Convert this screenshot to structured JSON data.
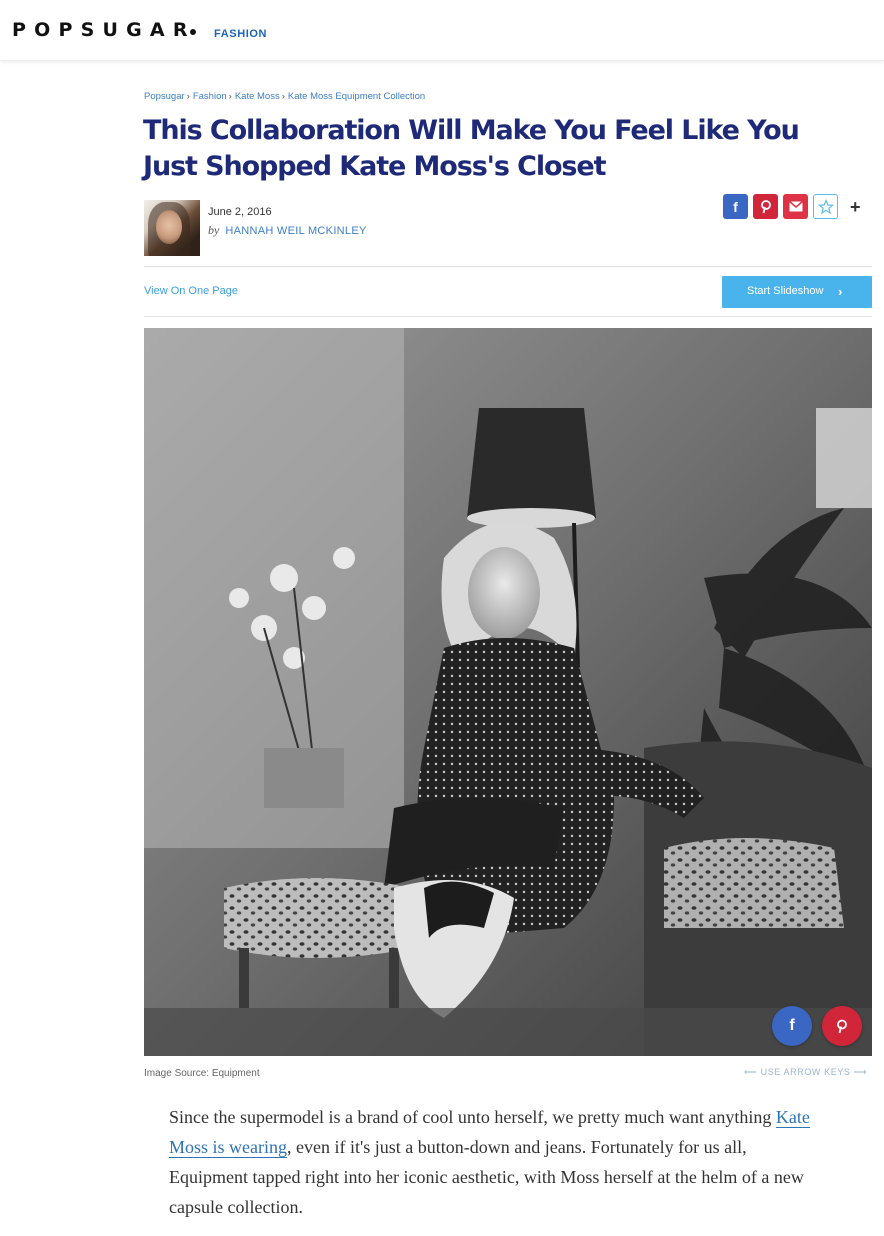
{
  "header": {
    "logo_text": "POPSUGAR",
    "section": "FASHION"
  },
  "breadcrumb": [
    "Popsugar",
    "Fashion",
    "Kate Moss",
    "Kate Moss Equipment Collection"
  ],
  "article": {
    "title": "This Collaboration Will Make You Feel Like You Just Shopped Kate Moss's Closet",
    "date": "June 2, 2016",
    "by_label": "by",
    "author": "HANNAH WEIL MCKINLEY",
    "view_one_page": "View On One Page",
    "start_slideshow": "Start Slideshow",
    "image_source": "Image Source: Equipment",
    "arrow_keys_hint": "⟵ USE ARROW KEYS ⟶",
    "body_before_link": "Since the supermodel is a brand of cool unto herself, we pretty much want anything ",
    "body_link": "Kate Moss is wearing",
    "body_after_link": ", even if it's just a button-down and jeans. Fortunately for us all, Equipment tapped right into her iconic aesthetic, with Moss herself at the helm of a new capsule collection."
  },
  "share": {
    "facebook_icon": "f",
    "pinterest_icon": "P",
    "email_icon": "✉",
    "favorite_icon": "☆",
    "more_icon": "+"
  },
  "colors": {
    "title": "#1e2a78",
    "link": "#3d7fc4",
    "facebook": "#3a66c4",
    "pinterest": "#d1253a",
    "slideshow": "#49b4ec"
  }
}
